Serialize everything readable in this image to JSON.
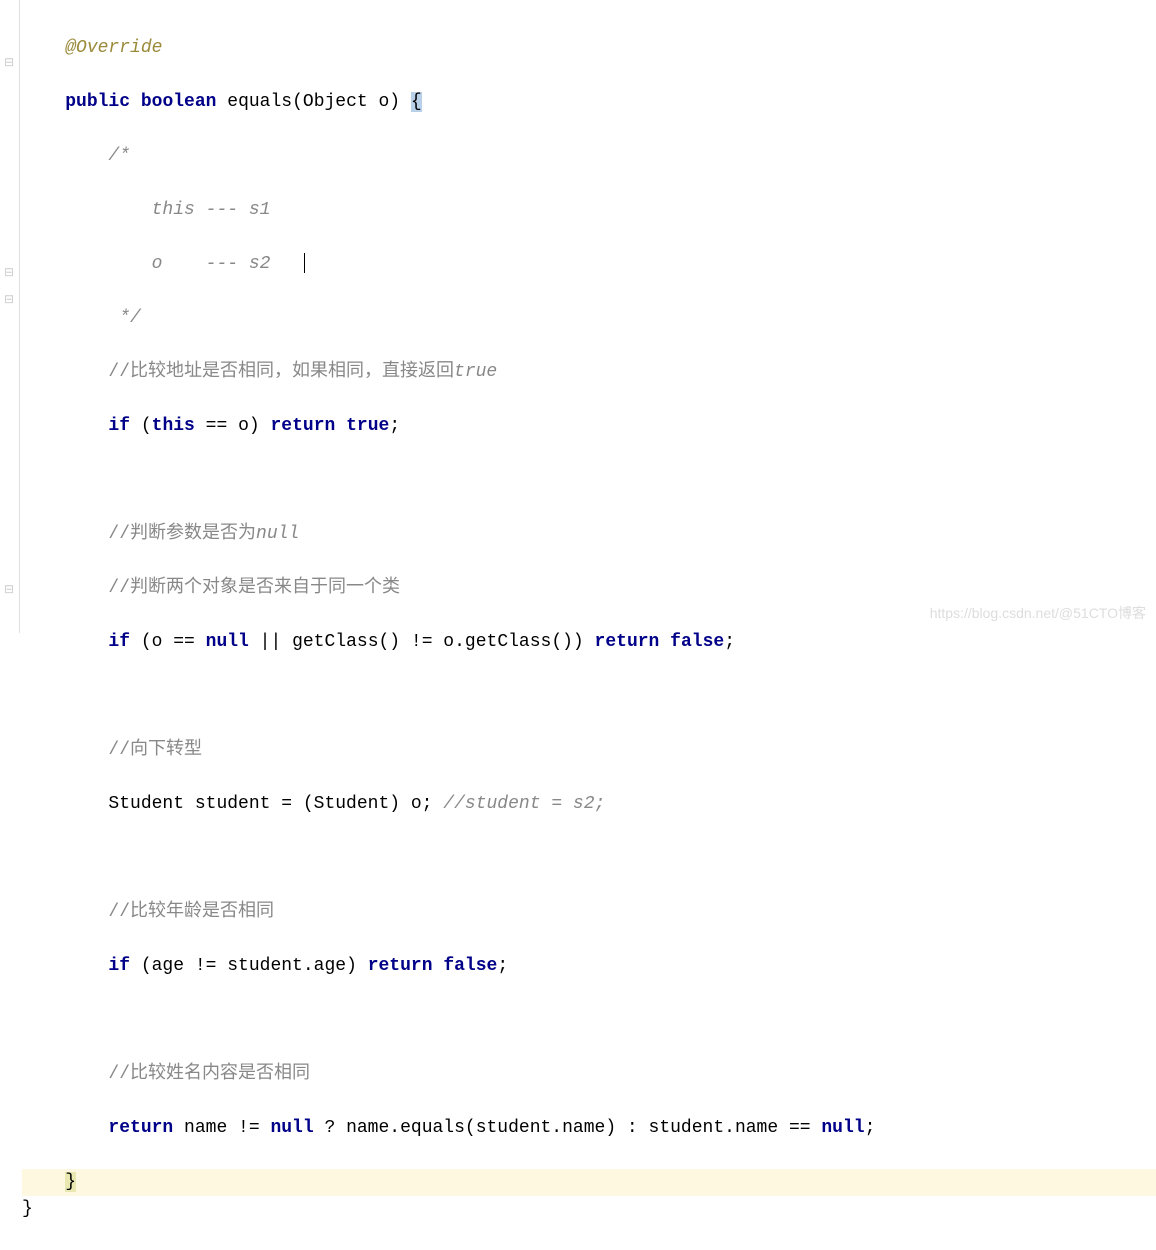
{
  "code": {
    "annotation": "@Override",
    "method_sig_public": "public",
    "method_sig_boolean": "boolean",
    "method_sig_name": "equals(Object o)",
    "open_brace": "{",
    "comment_block_1": "/*",
    "comment_block_2": "    this --- s1",
    "comment_block_3": "    o    --- s2",
    "comment_block_4": " */",
    "comment_addr": "//比较地址是否相同，如果相同，直接返回",
    "comment_addr_true": "true",
    "if_kw": "if",
    "this_kw": "this",
    "eq_o": " == o)",
    "return_kw": "return",
    "true_kw": "true",
    "semi": ";",
    "comment_null": "//判断参数是否为",
    "comment_null_kw": "null",
    "comment_class": "//判断两个对象是否来自于同一个类",
    "null_kw": "null",
    "getclass_part": " || getClass() != o.getClass())",
    "false_kw": "false",
    "comment_cast": "//向下转型",
    "cast_line": "Student student = (Student) o;",
    "cast_comment": "//student = s2;",
    "comment_age": "//比较年龄是否相同",
    "age_cond": " (age != student.age)",
    "comment_name": "//比较姓名内容是否相同",
    "return_name": " name != ",
    "name_rest": " ? name.equals(student.name) : student.name == ",
    "close_brace1": "}",
    "close_brace2": "}",
    "open_paren": " (",
    "o_eq": "(o == "
  },
  "watermark": "https://blog.csdn.net/@51CTO博客"
}
